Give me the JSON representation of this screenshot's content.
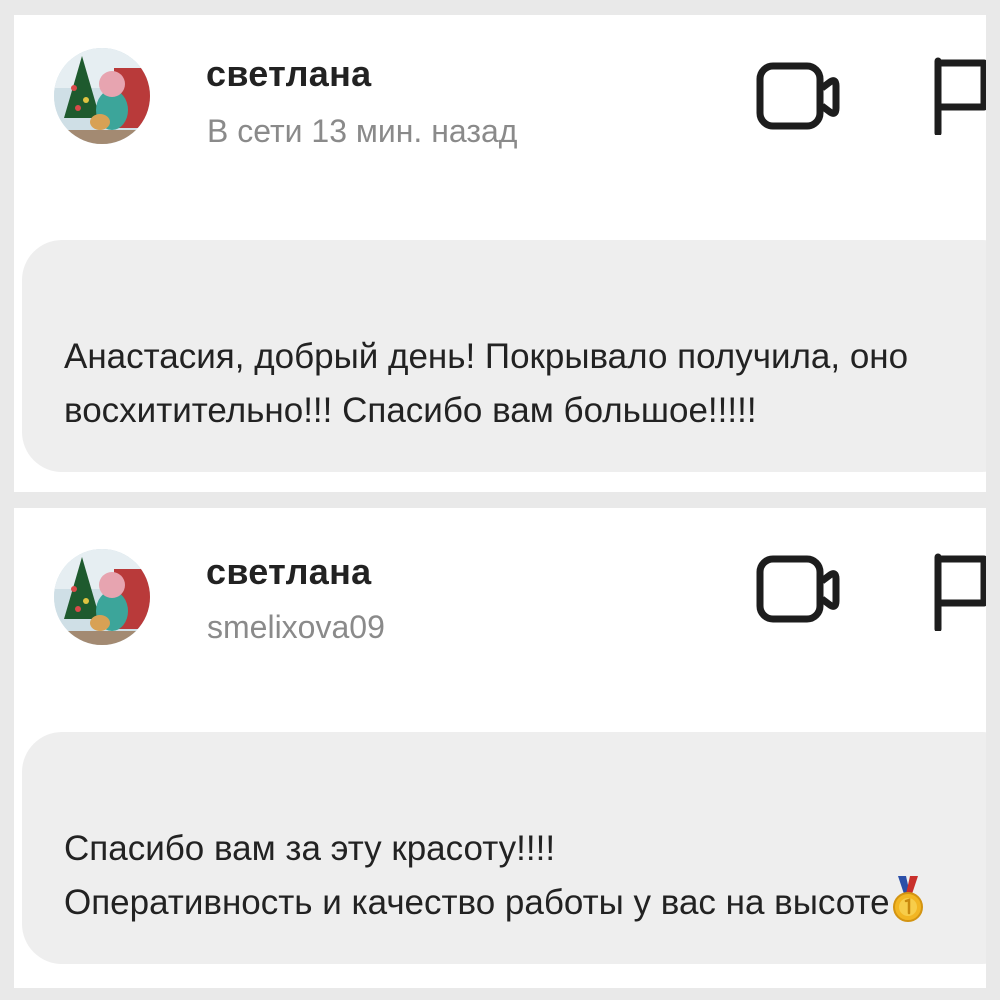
{
  "messages": [
    {
      "author": "светлана",
      "subline": "В сети 13 мин. назад",
      "text": "Анастасия, добрый день!  Покрывало получила, оно восхитительно!!! Спасибо вам большое!!!!!",
      "icons": [
        "avatar-photo",
        "video-call-icon",
        "report-flag-icon"
      ]
    },
    {
      "author": "светлана",
      "subline": "smelixova09",
      "text": "Спасибо вам за эту красоту!!!!\nОперативность и качество работы у вас на высоте",
      "trailing_emoji": "1st-place-medal",
      "icons": [
        "avatar-photo",
        "video-call-icon",
        "report-flag-icon"
      ]
    }
  ],
  "colors": {
    "background": "#e9e9e9",
    "card": "#ffffff",
    "bubble": "#eeeeee",
    "text": "#222222",
    "muted": "#8a8a8a"
  }
}
